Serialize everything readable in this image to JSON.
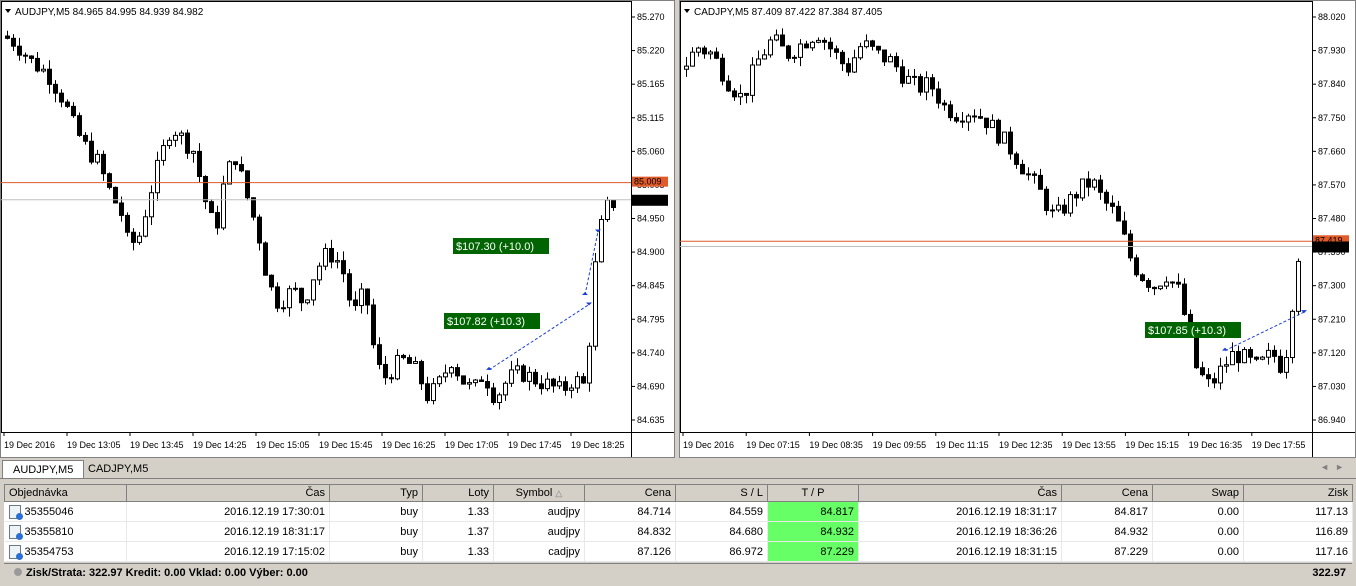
{
  "colors": {
    "bar_down": "#000000",
    "bar_up": "#ffffff",
    "bid_line": "#e05a2a",
    "ask_line": "#bfbfbf",
    "tp_label_bg": "#006400",
    "trade_line": "#1a3fd6",
    "tp_cell": "#66ff66"
  },
  "charts": [
    {
      "id": "audjpy",
      "header": "AUDJPY,M5  84.965 84.995 84.939 84.982",
      "prices": [
        "85.270",
        "85.220",
        "85.165",
        "85.115",
        "85.060",
        "85.005",
        "84.950",
        "84.900",
        "84.845",
        "84.795",
        "84.740",
        "84.690",
        "84.635"
      ],
      "times": [
        "19 Dec 2016",
        "19 Dec 13:05",
        "19 Dec 13:45",
        "19 Dec 14:25",
        "19 Dec 15:05",
        "19 Dec 15:45",
        "19 Dec 16:25",
        "19 Dec 17:05",
        "19 Dec 17:45",
        "19 Dec 18:25"
      ],
      "bid_tag": "84.982",
      "ask_tag": "85.009",
      "labels": [
        {
          "text": "$107.30 (+10.0)"
        },
        {
          "text": "$107.82 (+10.3)"
        }
      ],
      "ylim": [
        84.635,
        85.27
      ]
    },
    {
      "id": "cadjpy",
      "header": "CADJPY,M5  87.409 87.422 87.384 87.405",
      "prices": [
        "88.020",
        "87.930",
        "87.840",
        "87.750",
        "87.660",
        "87.570",
        "87.480",
        "87.390",
        "87.300",
        "87.210",
        "87.120",
        "87.030",
        "86.940"
      ],
      "times": [
        "19 Dec 2016",
        "19 Dec 07:15",
        "19 Dec 08:35",
        "19 Dec 09:55",
        "19 Dec 11:15",
        "19 Dec 12:35",
        "19 Dec 13:55",
        "19 Dec 15:15",
        "19 Dec 16:35",
        "19 Dec 17:55"
      ],
      "bid_tag": "87.405",
      "ask_tag": "87.419",
      "labels": [
        {
          "text": "$107.85 (+10.3)"
        }
      ],
      "ylim": [
        86.94,
        88.02
      ]
    }
  ],
  "tabs": [
    {
      "label": "AUDJPY,M5",
      "active": true
    },
    {
      "label": "CADJPY,M5",
      "active": false
    }
  ],
  "table": {
    "headers": [
      "Objednávka",
      "Čas",
      "Typ",
      "Loty",
      "Symbol",
      "Cena",
      "S / L",
      "T / P",
      "Čas",
      "Cena",
      "Swap",
      "Zisk"
    ],
    "rows": [
      [
        "35355046",
        "2016.12.19 17:30:01",
        "buy",
        "1.33",
        "audjpy",
        "84.714",
        "84.559",
        "84.817",
        "2016.12.19 18:31:17",
        "84.817",
        "0.00",
        "117.13"
      ],
      [
        "35355810",
        "2016.12.19 18:31:17",
        "buy",
        "1.37",
        "audjpy",
        "84.832",
        "84.680",
        "84.932",
        "2016.12.19 18:36:26",
        "84.932",
        "0.00",
        "116.89"
      ],
      [
        "35354753",
        "2016.12.19 17:15:02",
        "buy",
        "1.33",
        "cadjpy",
        "87.126",
        "86.972",
        "87.229",
        "2016.12.19 18:31:15",
        "87.229",
        "0.00",
        "117.16"
      ]
    ]
  },
  "summary": {
    "text": "Zisk/Strata: 322.97  Kredit: 0.00  Vklad: 0.00  Výber: 0.00",
    "total": "322.97"
  }
}
